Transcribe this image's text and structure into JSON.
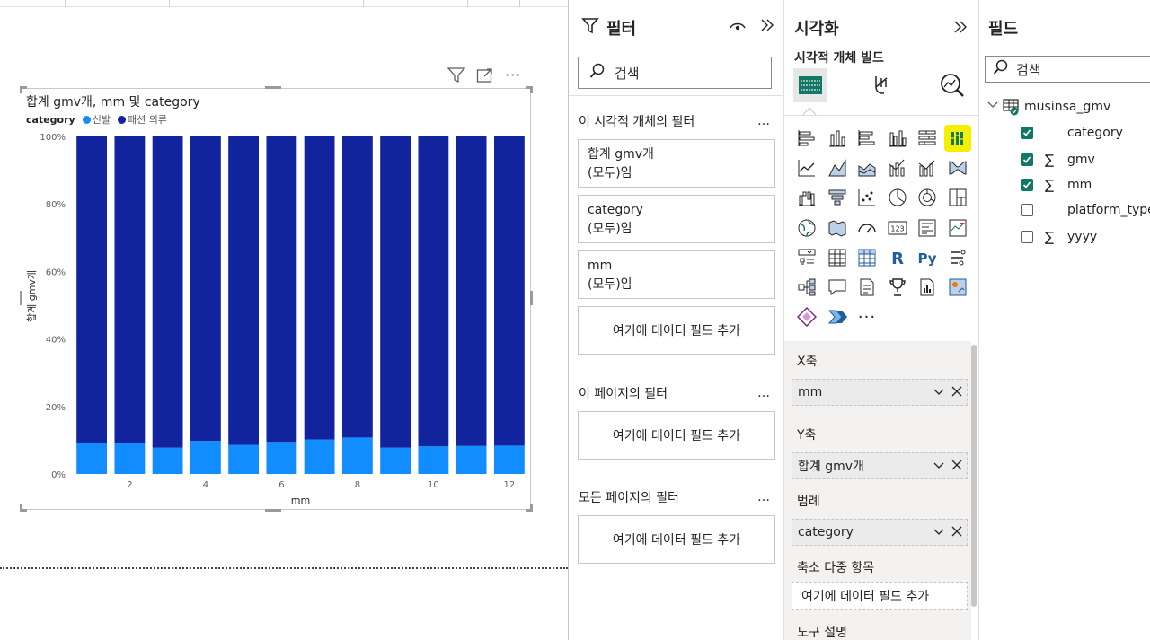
{
  "colors": {
    "accent_dark": "#12239e",
    "accent_light": "#118dff",
    "check": "#117865",
    "highlight": "#f6f000"
  },
  "visual": {
    "title": "합계 gmv개, mm 및 category",
    "legend_title": "category",
    "legend_items": [
      {
        "name": "신발",
        "color": "#118dff"
      },
      {
        "name": "패션 의류",
        "color": "#12239e"
      }
    ],
    "header_icons": [
      "filter-icon",
      "focus-mode-icon",
      "more-options-icon"
    ]
  },
  "chart_data": {
    "type": "bar",
    "stacked": "100%",
    "title": "합계 gmv개, mm 및 category",
    "xlabel": "mm",
    "ylabel": "합계 gmv개",
    "x": [
      1,
      2,
      3,
      4,
      5,
      6,
      7,
      8,
      9,
      10,
      11,
      12
    ],
    "x_tick_labels": [
      "2",
      "4",
      "6",
      "8",
      "10",
      "12"
    ],
    "y_tick_labels": [
      "0%",
      "20%",
      "40%",
      "60%",
      "80%",
      "100%"
    ],
    "ylim": [
      0,
      100
    ],
    "series": [
      {
        "name": "신발",
        "values": [
          9.2,
          9.2,
          7.8,
          9.8,
          8.6,
          9.5,
          10.2,
          10.8,
          7.8,
          8.2,
          8.3,
          8.4
        ]
      },
      {
        "name": "패션 의류",
        "values": [
          90.8,
          90.8,
          92.2,
          90.2,
          91.4,
          90.5,
          89.8,
          89.2,
          92.2,
          91.8,
          91.7,
          91.6
        ]
      }
    ],
    "legend": "top-left"
  },
  "filters": {
    "title": "필터",
    "search_placeholder": "검색",
    "visual_section": "이 시각적 개체의 필터",
    "page_section": "이 페이지의 필터",
    "all_pages_section": "모든 페이지의 필터",
    "more": "…",
    "cards": [
      {
        "name": "합계 gmv개",
        "state": "(모두)임"
      },
      {
        "name": "category",
        "state": "(모두)임"
      },
      {
        "name": "mm",
        "state": "(모두)임"
      }
    ],
    "add_field": "여기에 데이터 필드 추가"
  },
  "viz": {
    "title": "시각화",
    "subtitle": "시각적 개체 빌드",
    "x_axis_label": "X축",
    "x_axis_field": "mm",
    "y_axis_label": "Y축",
    "y_axis_field": "합계 gmv개",
    "legend_label": "범례",
    "legend_field": "category",
    "small_multiples_label": "축소 다중 항목",
    "small_multiples_placeholder": "여기에 데이터 필드 추가",
    "tooltips_label": "도구 설명",
    "more_visuals": "···"
  },
  "fields": {
    "title": "필드",
    "search_placeholder": "검색",
    "table_name": "musinsa_gmv",
    "items": [
      {
        "name": "category",
        "checked": true,
        "sigma": false
      },
      {
        "name": "gmv",
        "checked": true,
        "sigma": true
      },
      {
        "name": "mm",
        "checked": true,
        "sigma": true
      },
      {
        "name": "platform_type",
        "checked": false,
        "sigma": false
      },
      {
        "name": "yyyy",
        "checked": false,
        "sigma": true
      }
    ],
    "sigma_symbol": "∑"
  }
}
